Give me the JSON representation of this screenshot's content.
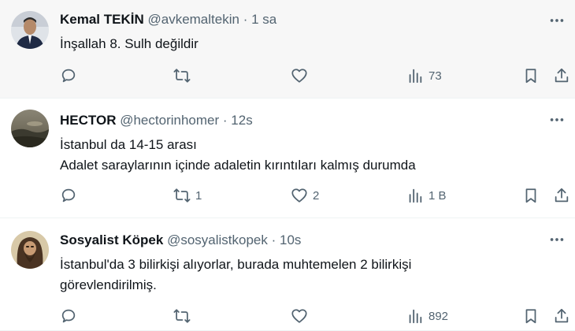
{
  "colors": {
    "icon": "#536471",
    "text": "#0f1419",
    "highlight_bg": "#f7f7f7"
  },
  "tweets": [
    {
      "name": "Kemal TEKİN",
      "handle": "@avkemaltekin",
      "separator": "·",
      "time": "1 sa",
      "lines": [
        "İnşallah 8. Sulh değildir"
      ],
      "replies": "",
      "retweets": "",
      "likes": "",
      "views": "73",
      "avatar": "avatar-photo-man-suit"
    },
    {
      "name": "HECTOR",
      "handle": "@hectorinhomer",
      "separator": "·",
      "time": "12s",
      "lines": [
        "İstanbul da 14-15 arası",
        "Adalet saraylarının içinde adaletin kırıntıları kalmış durumda"
      ],
      "replies": "",
      "retweets": "1",
      "likes": "2",
      "views": "1 B",
      "avatar": "avatar-photo-landscape"
    },
    {
      "name": "Sosyalist Köpek",
      "handle": "@sosyalistkopek",
      "separator": "·",
      "time": "10s",
      "lines": [
        "İstanbul'da 3 bilirkişi alıyorlar, burada muhtemelen 2 bilirkişi",
        "görevlendirilmiş."
      ],
      "replies": "",
      "retweets": "",
      "likes": "",
      "views": "892",
      "avatar": "avatar-photo-bearded-man"
    }
  ]
}
